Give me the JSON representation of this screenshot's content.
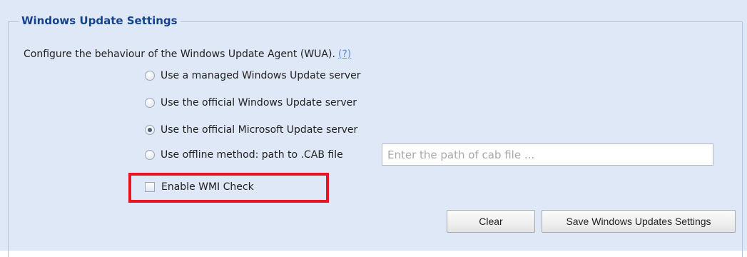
{
  "panel": {
    "title": "Windows Update Settings",
    "description": "Configure the behaviour of the Windows Update Agent (WUA).",
    "help_link": "(?)"
  },
  "options": [
    {
      "label": "Use a managed Windows Update server",
      "checked": false
    },
    {
      "label": "Use the official Windows Update server",
      "checked": false
    },
    {
      "label": "Use the official Microsoft Update server",
      "checked": true
    },
    {
      "label": "Use offline method: path to .CAB file",
      "checked": false
    }
  ],
  "cab_input": {
    "value": "",
    "placeholder": "Enter the path of cab file ..."
  },
  "wmi_check": {
    "label": "Enable WMI Check",
    "checked": false
  },
  "buttons": {
    "clear": "Clear",
    "save": "Save Windows Updates Settings"
  },
  "colors": {
    "panel_background": "#dfe8f6",
    "legend_text": "#15428b",
    "highlight": "#e8141f",
    "link": "#5b8ed6"
  },
  "icons": {
    "radio": "radio-button",
    "checkbox": "checkbox"
  }
}
